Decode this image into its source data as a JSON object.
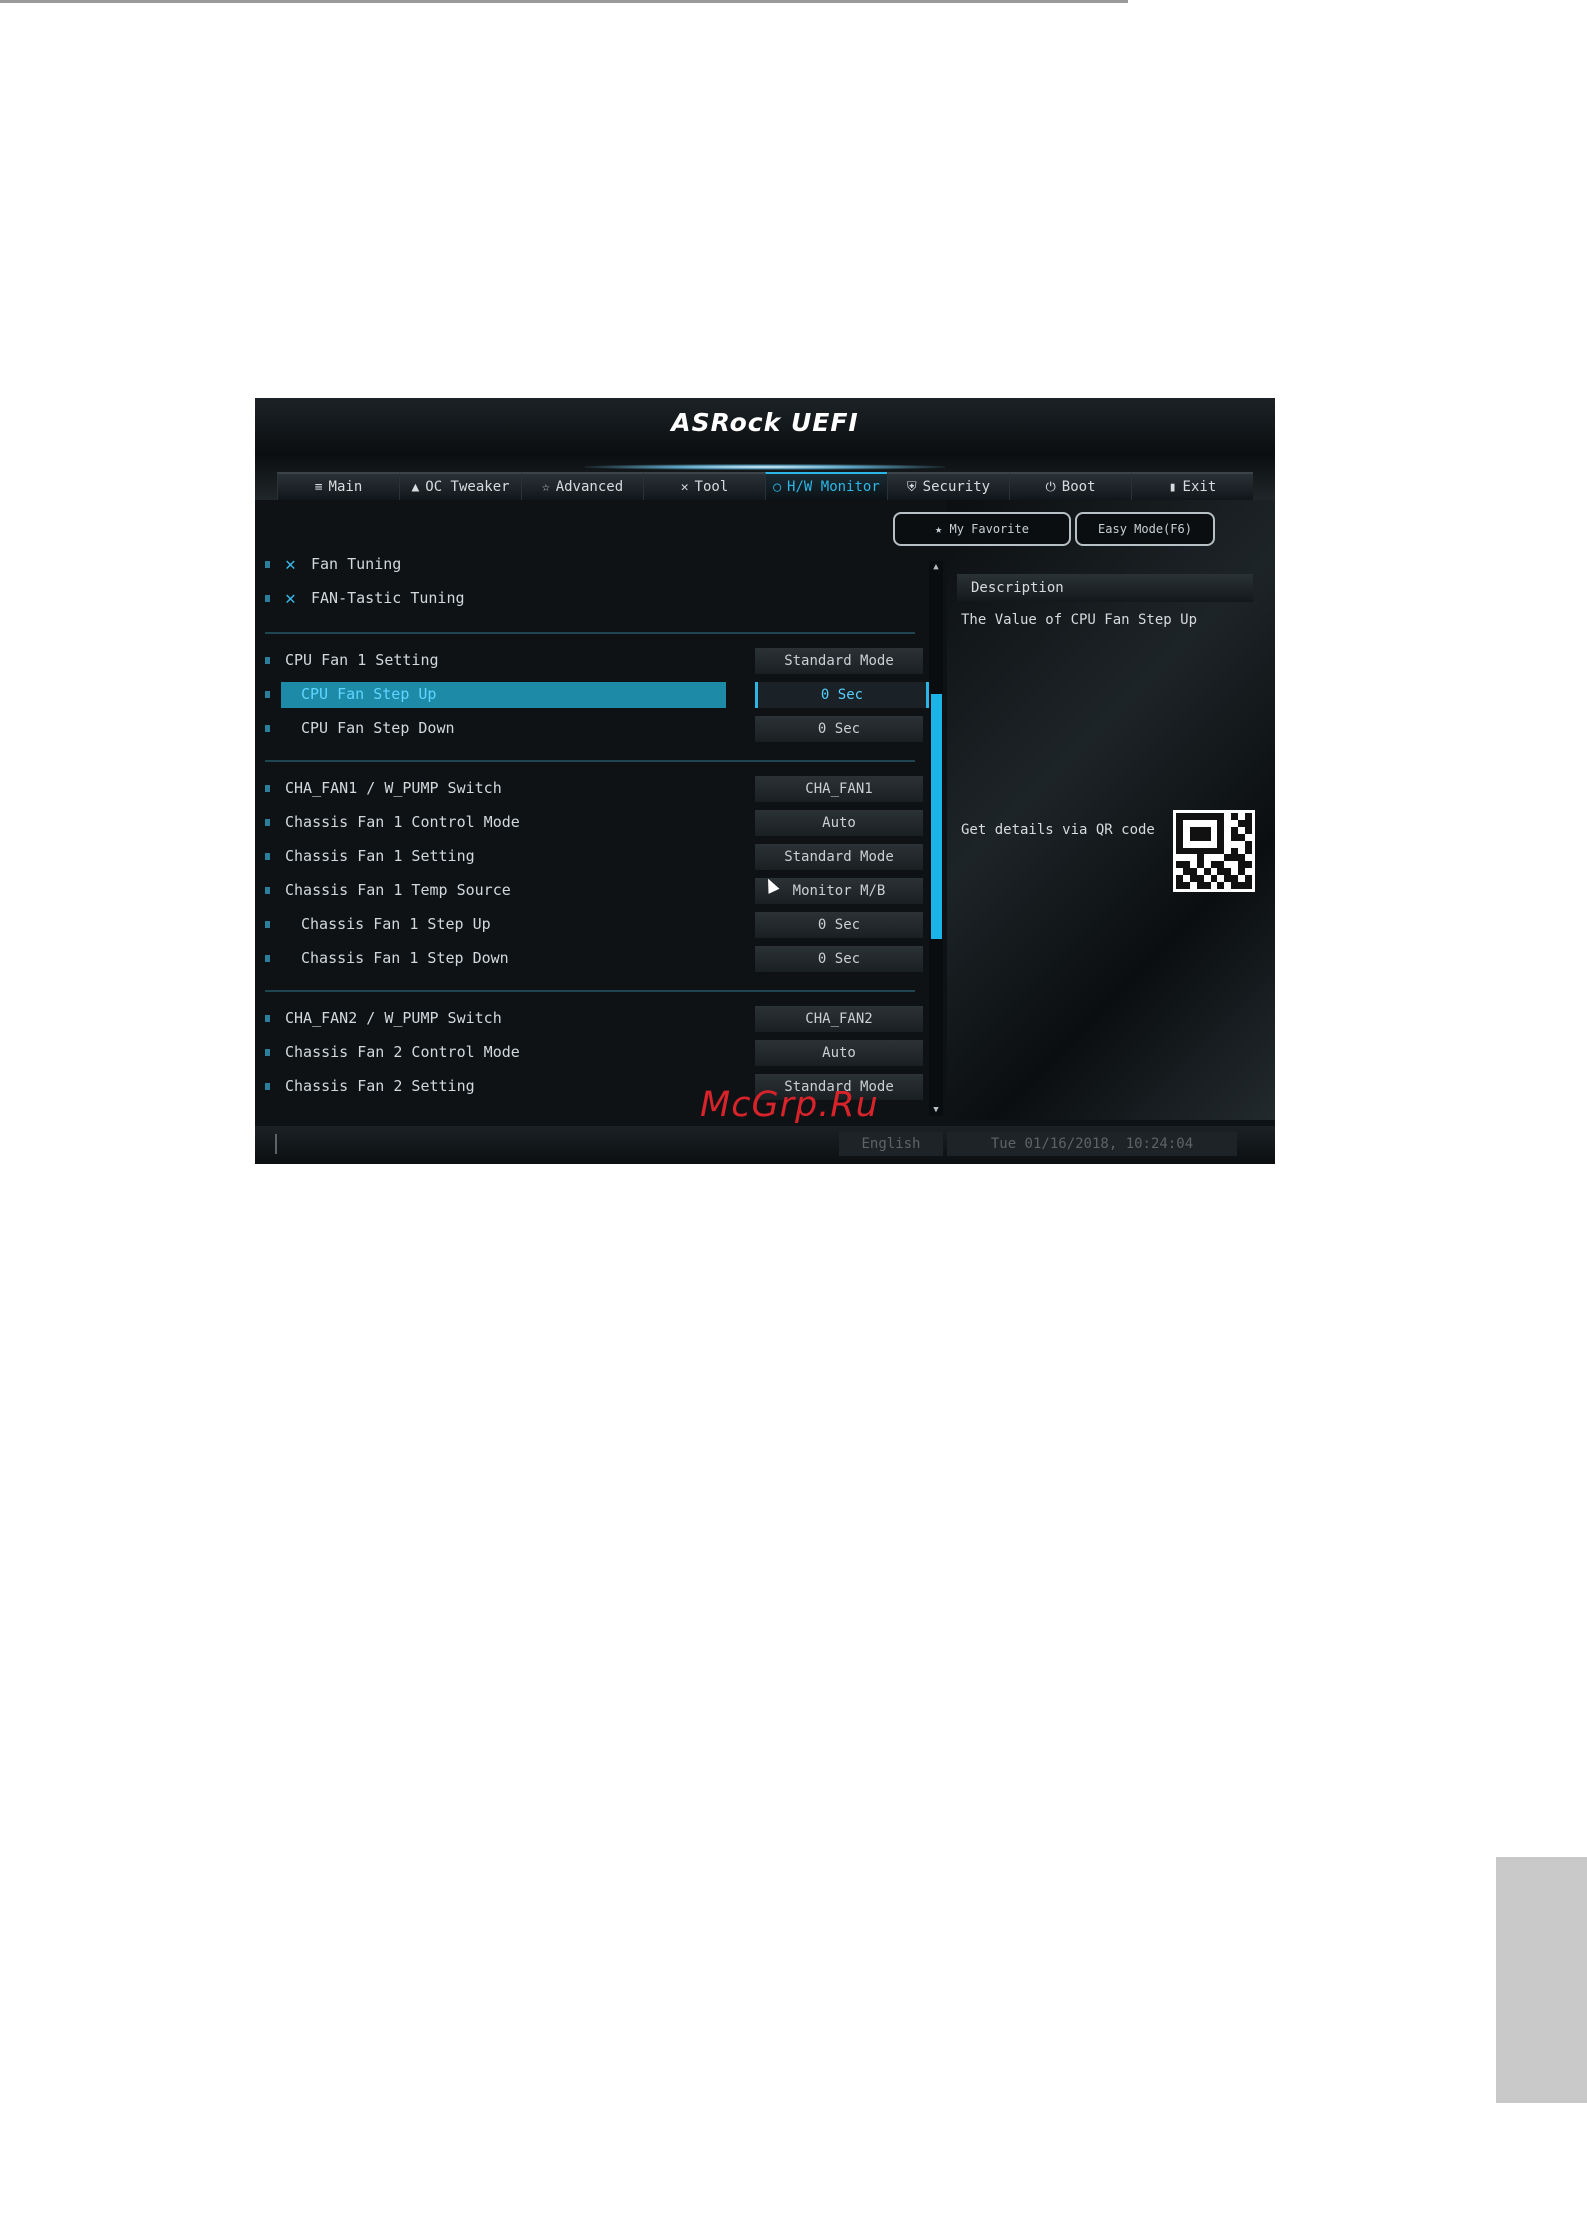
{
  "header": {
    "brand": "ASRock UEFI"
  },
  "tabs": [
    {
      "icon": "≡",
      "label": "Main"
    },
    {
      "icon": "▲",
      "label": "OC Tweaker"
    },
    {
      "icon": "☆",
      "label": "Advanced"
    },
    {
      "icon": "✕",
      "label": "Tool"
    },
    {
      "icon": "◯",
      "label": "H/W Monitor"
    },
    {
      "icon": "⛨",
      "label": "Security"
    },
    {
      "icon": "⏻",
      "label": "Boot"
    },
    {
      "icon": "▮",
      "label": "Exit"
    }
  ],
  "active_tab": "H/W Monitor",
  "tools": [
    {
      "icon": "wrench-cross-icon",
      "label": "Fan Tuning"
    },
    {
      "icon": "wrench-cross-icon",
      "label": "FAN-Tastic Tuning"
    }
  ],
  "settings": [
    {
      "label": "CPU Fan 1 Setting",
      "value": "Standard Mode"
    },
    {
      "label": "CPU Fan Step Up",
      "value": "0 Sec"
    },
    {
      "label": "CPU Fan Step Down",
      "value": "0 Sec"
    },
    {
      "label": "CHA_FAN1 / W_PUMP Switch",
      "value": "CHA_FAN1"
    },
    {
      "label": "Chassis Fan 1 Control Mode",
      "value": "Auto"
    },
    {
      "label": "Chassis Fan 1 Setting",
      "value": "Standard Mode"
    },
    {
      "label": "Chassis Fan 1 Temp Source",
      "value": "Monitor M/B"
    },
    {
      "label": "Chassis Fan 1 Step Up",
      "value": "0 Sec"
    },
    {
      "label": "Chassis Fan 1 Step Down",
      "value": "0 Sec"
    },
    {
      "label": "CHA_FAN2 / W_PUMP Switch",
      "value": "CHA_FAN2"
    },
    {
      "label": "Chassis Fan 2 Control Mode",
      "value": "Auto"
    },
    {
      "label": "Chassis Fan 2 Setting",
      "value": "Standard Mode"
    }
  ],
  "selected_setting": "CPU Fan Step Up",
  "right_panel": {
    "my_favorite": "My Favorite",
    "easy_mode": "Easy Mode(F6)",
    "description_title": "Description",
    "description_text": "The Value of CPU Fan Step Up",
    "qr_label": "Get details via QR code"
  },
  "footer": {
    "language": "English",
    "datetime": "Tue 01/16/2018, 10:24:04"
  },
  "watermark": "McGrp.Ru",
  "colors": {
    "accent": "#1ab4e8",
    "highlight": "#1d8aa8",
    "background": "#0e1215",
    "watermark": "#d8232a"
  }
}
